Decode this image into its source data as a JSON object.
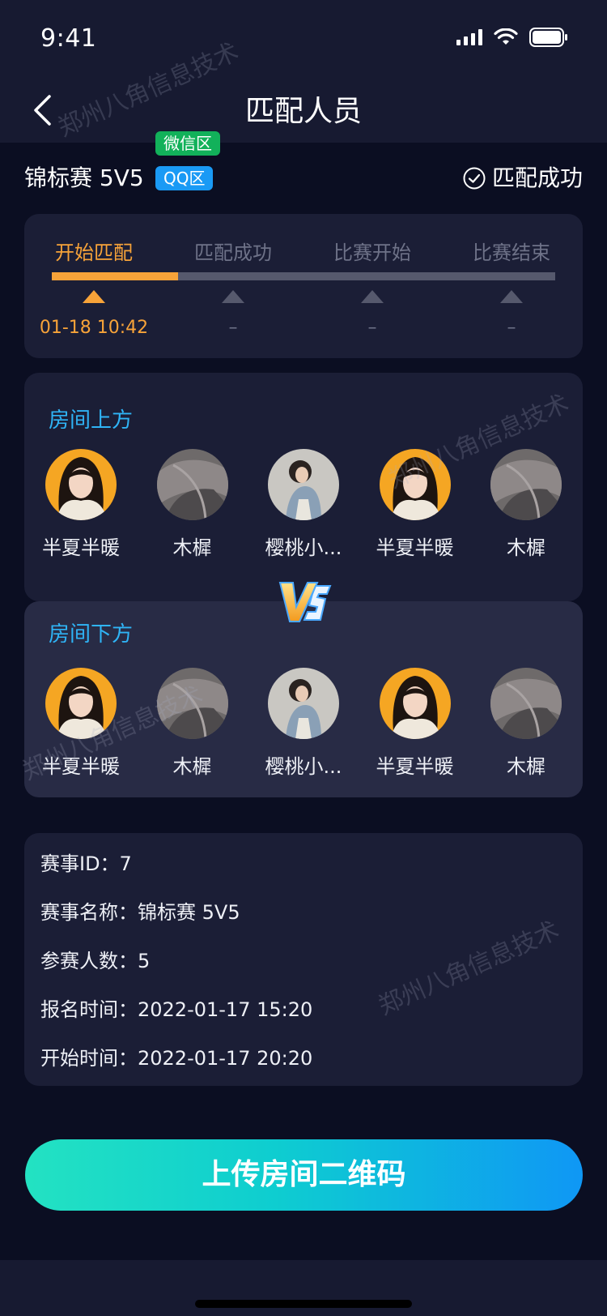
{
  "status": {
    "time": "9:41"
  },
  "nav": {
    "title": "匹配人员"
  },
  "header": {
    "event_name": "锦标赛 5V5",
    "tag_wechat": "微信区",
    "tag_qq": "QQ区",
    "match_status": "匹配成功"
  },
  "progress": {
    "steps": [
      {
        "label": "开始匹配",
        "time": "01-18 10:42",
        "active": true
      },
      {
        "label": "匹配成功",
        "time": "–",
        "active": false
      },
      {
        "label": "比赛开始",
        "time": "–",
        "active": false
      },
      {
        "label": "比赛结束",
        "time": "–",
        "active": false
      }
    ],
    "completed_fraction": 0.25
  },
  "room_top": {
    "label": "房间上方",
    "players": [
      "半夏半暖",
      "木樨",
      "樱桃小...",
      "半夏半暖",
      "木樨"
    ]
  },
  "room_bottom": {
    "label": "房间下方",
    "players": [
      "半夏半暖",
      "木樨",
      "樱桃小...",
      "半夏半暖",
      "木樨"
    ]
  },
  "info": {
    "event_id": "赛事ID：7",
    "event_title": "赛事名称：锦标赛 5V5",
    "participants": "参赛人数：5",
    "signup_time": "报名时间：2022-01-17 15:20",
    "start_time": "开始时间：2022-01-17 20:20"
  },
  "actions": {
    "upload_label": "上传房间二维码"
  },
  "watermark": "郑州八角信息技术",
  "colors": {
    "accent_orange": "#f7a339",
    "room_label_blue": "#2fb4f6",
    "wechat_green": "#12b15a",
    "qq_blue": "#1a9af5"
  },
  "icons": {
    "back": "chevron-left-icon",
    "status_ok": "check-circle-icon",
    "vs": "vs-badge-icon"
  }
}
